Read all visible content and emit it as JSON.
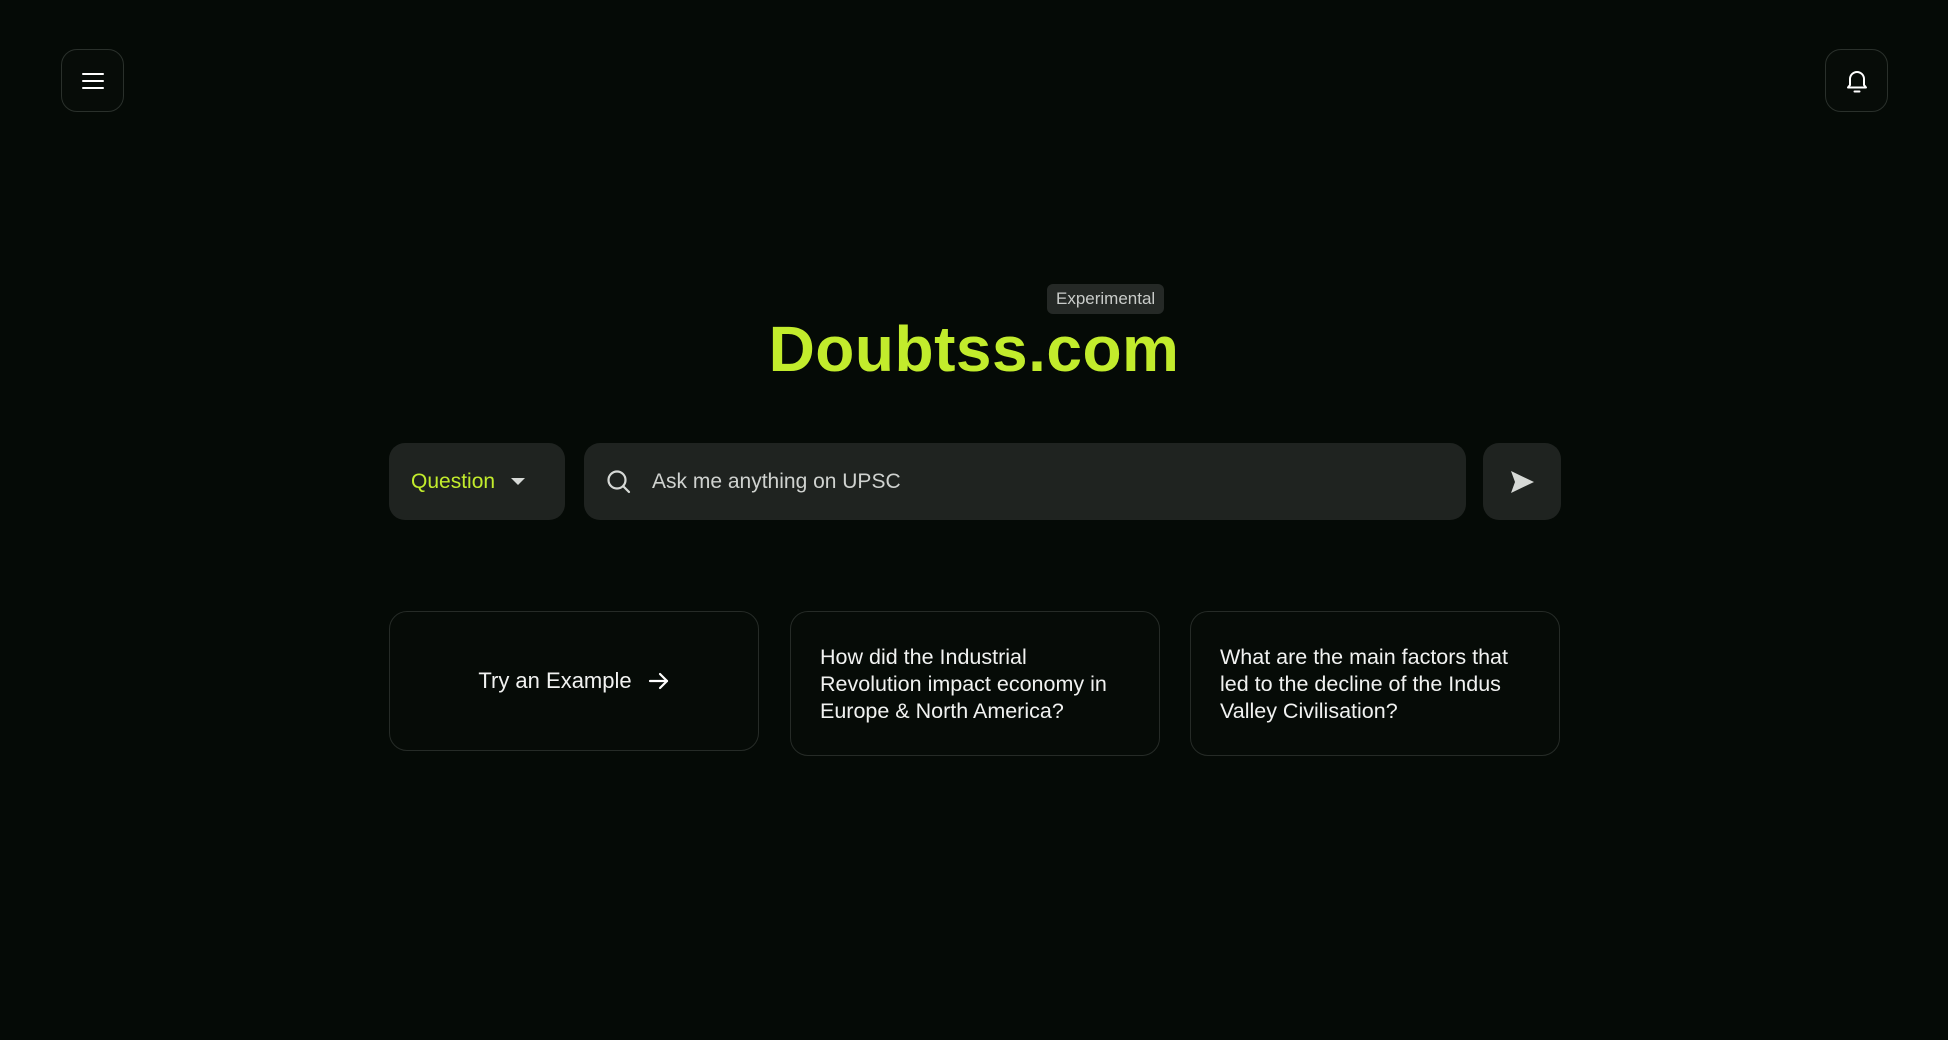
{
  "header": {
    "menu_icon": "hamburger-menu-icon",
    "notifications_icon": "bell-icon"
  },
  "hero": {
    "badge": "Experimental",
    "title": "Doubtss.com"
  },
  "search": {
    "mode_selected": "Question",
    "placeholder": "Ask me anything on UPSC",
    "value": "",
    "search_icon": "search-icon",
    "send_icon": "send-icon"
  },
  "examples": {
    "try_label": "Try an Example",
    "items": [
      "How did the Industrial Revolution impact economy in Europe & North America?",
      "What are the main factors that led to the decline of the Indus Valley Civilisation?"
    ]
  },
  "colors": {
    "background": "#050a06",
    "accent": "#c2ec2c",
    "surface": "#1f2320",
    "border": "#262b27"
  }
}
